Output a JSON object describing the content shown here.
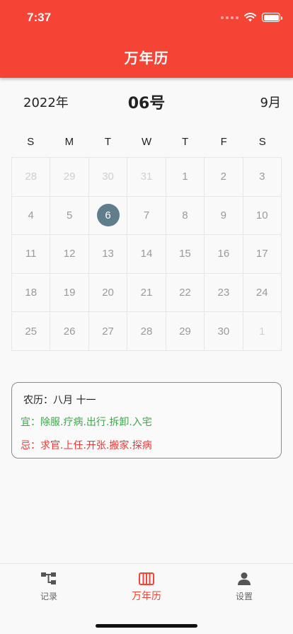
{
  "status": {
    "time": "7:37"
  },
  "header": {
    "title": "万年历"
  },
  "date_row": {
    "year": "2022年",
    "day": "06号",
    "month": "9月"
  },
  "calendar": {
    "weekdays": [
      "S",
      "M",
      "T",
      "W",
      "T",
      "F",
      "S"
    ],
    "selected_day": "6",
    "rows": [
      [
        {
          "d": "28",
          "other": true
        },
        {
          "d": "29",
          "other": true
        },
        {
          "d": "30",
          "other": true
        },
        {
          "d": "31",
          "other": true
        },
        {
          "d": "1"
        },
        {
          "d": "2"
        },
        {
          "d": "3"
        }
      ],
      [
        {
          "d": "4"
        },
        {
          "d": "5"
        },
        {
          "d": "6",
          "selected": true
        },
        {
          "d": "7"
        },
        {
          "d": "8"
        },
        {
          "d": "9"
        },
        {
          "d": "10"
        }
      ],
      [
        {
          "d": "11"
        },
        {
          "d": "12"
        },
        {
          "d": "13"
        },
        {
          "d": "14"
        },
        {
          "d": "15"
        },
        {
          "d": "16"
        },
        {
          "d": "17"
        }
      ],
      [
        {
          "d": "18"
        },
        {
          "d": "19"
        },
        {
          "d": "20"
        },
        {
          "d": "21"
        },
        {
          "d": "22"
        },
        {
          "d": "23"
        },
        {
          "d": "24"
        }
      ],
      [
        {
          "d": "25"
        },
        {
          "d": "26"
        },
        {
          "d": "27"
        },
        {
          "d": "28"
        },
        {
          "d": "29"
        },
        {
          "d": "30"
        },
        {
          "d": "1",
          "other": true
        }
      ]
    ]
  },
  "info": {
    "lunar": "农历：八月  十一",
    "yi": "宜：除服.疗病.出行.拆卸.入宅",
    "ji": "忌：求官.上任.开张.搬家.探病"
  },
  "tabs": [
    {
      "label": "记录",
      "icon": "tree-structure-icon",
      "active": false
    },
    {
      "label": "万年历",
      "icon": "calendar-columns-icon",
      "active": true
    },
    {
      "label": "设置",
      "icon": "person-icon",
      "active": false
    }
  ],
  "colors": {
    "accent": "#f54336",
    "selected_day": "#607d8b",
    "yi": "#3fa64a",
    "ji": "#e53935"
  }
}
